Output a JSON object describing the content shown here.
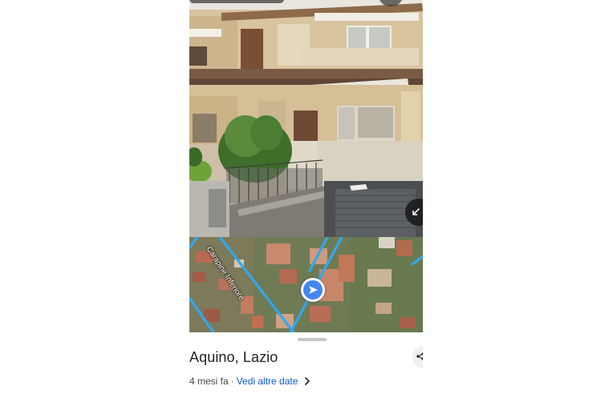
{
  "streetview": {
    "place_title": "Aquino, Lazio",
    "capture_age": "4 mesi fa",
    "separator": "·",
    "more_dates_link": "Vedi altre date"
  },
  "map": {
    "street_label": "Carapine Inferiore"
  },
  "colors": {
    "route_blue": "#2fa9f0",
    "accent": "#4285f4",
    "link": "#0b57d0"
  },
  "icons": [
    "expand-icon",
    "navigation-arrow-icon",
    "share-icon",
    "chevron-right-icon"
  ]
}
